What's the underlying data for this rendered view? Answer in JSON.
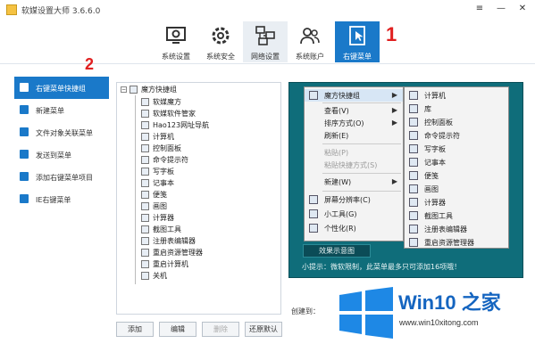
{
  "window": {
    "title": "软媒设置大师 3.6.6.0",
    "controls": [
      "≡",
      "—",
      "✕"
    ]
  },
  "toolbar": {
    "tabs": [
      {
        "label": "系统设置",
        "icon": "monitor-gear-icon"
      },
      {
        "label": "系统安全",
        "icon": "gear-icon"
      },
      {
        "label": "网络设置",
        "icon": "network-icon"
      },
      {
        "label": "系统账户",
        "icon": "users-icon"
      },
      {
        "label": "右键菜单",
        "icon": "cursor-icon"
      }
    ]
  },
  "annotations": {
    "one": "1",
    "two": "2",
    "color": "#e02020"
  },
  "sidebar": {
    "items": [
      {
        "label": "右键菜单快捷组",
        "active": true
      },
      {
        "label": "新建菜单"
      },
      {
        "label": "文件对象关联菜单"
      },
      {
        "label": "发送到菜单"
      },
      {
        "label": "添加右键菜单项目"
      },
      {
        "label": "IE右键菜单"
      }
    ]
  },
  "tree": {
    "root": "魔方快捷组",
    "children": [
      "软媒魔方",
      "软媒软件管家",
      "Hao123网址导航",
      "计算机",
      "控制面板",
      "命令提示符",
      "写字板",
      "记事本",
      "便笺",
      "画图",
      "计算器",
      "截图工具",
      "注册表编辑器",
      "重启资源管理器",
      "重启计算机",
      "关机"
    ]
  },
  "buttons": {
    "add": "添加",
    "edit": "编辑",
    "delete": "删除",
    "restore": "还原默认"
  },
  "preview": {
    "context_menu": [
      {
        "label": "魔方快捷组",
        "arrow": "▶"
      },
      {
        "label": "查看(V)",
        "arrow": "▶"
      },
      {
        "label": "排序方式(O)",
        "arrow": "▶"
      },
      {
        "label": "刷新(E)"
      },
      {
        "label": "粘贴(P)",
        "disabled": true
      },
      {
        "label": "粘贴快捷方式(S)",
        "disabled": true
      },
      {
        "label": "新建(W)",
        "arrow": "▶"
      },
      {
        "label": "屏幕分辨率(C)"
      },
      {
        "label": "小工具(G)"
      },
      {
        "label": "个性化(R)"
      }
    ],
    "submenu": [
      "计算机",
      "库",
      "控制面板",
      "命令提示符",
      "写字板",
      "记事本",
      "便笺",
      "画图",
      "计算器",
      "截图工具",
      "注册表编辑器",
      "重启资源管理器"
    ],
    "effect_button": "效果示意图",
    "tip": "小提示：微软限制，此菜单最多只可添加16项哦！"
  },
  "created_label": "创建到：",
  "watermark": {
    "brand": "Win10 之家",
    "url": "www.win10xitong.com"
  },
  "colors": {
    "accent": "#1a79c9",
    "preview_bg": "#0f6d7a",
    "watermark_blue": "#1565c0"
  }
}
